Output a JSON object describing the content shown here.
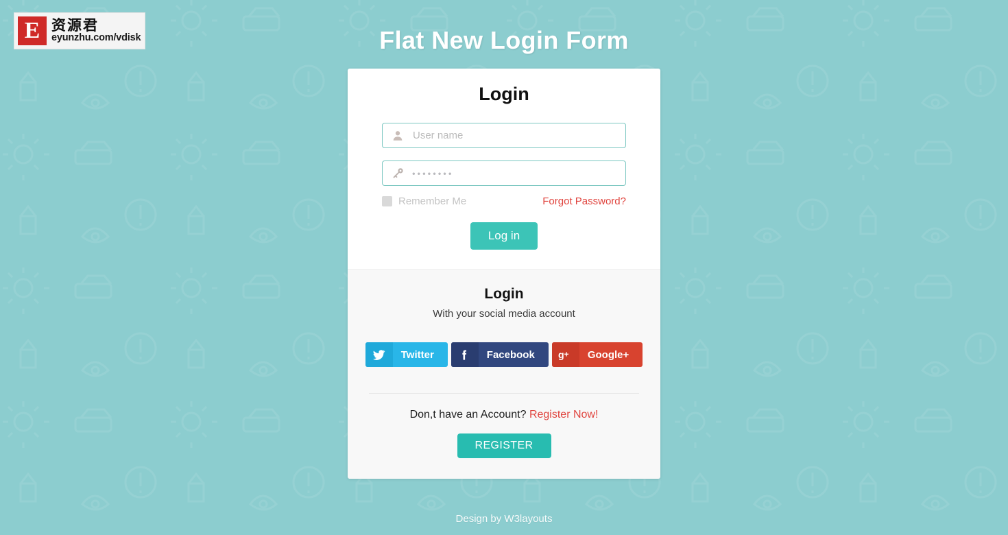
{
  "watermark": {
    "mark_letter": "E",
    "chinese": "资源君",
    "url": "eyunzhu.com/vdisk"
  },
  "page": {
    "title": "Flat New Login Form",
    "background_color": "#8ccdcf"
  },
  "login_card": {
    "heading": "Login",
    "username": {
      "value": "",
      "placeholder": "User name",
      "icon": "user-icon"
    },
    "password": {
      "value": "",
      "masked_display": "••••••••",
      "placeholder": "",
      "icon": "key-icon"
    },
    "remember_label": "Remember Me",
    "remember_checked": false,
    "forgot_label": "Forgot Password?",
    "forgot_color": "#e0443e",
    "submit_label": "Log in",
    "submit_color": "#3cc4b7"
  },
  "social_section": {
    "heading": "Login",
    "subtitle": "With your social media account",
    "buttons": [
      {
        "label": "Twitter",
        "icon": "twitter-icon",
        "color": "#29b6e8"
      },
      {
        "label": "Facebook",
        "icon": "facebook-icon",
        "color": "#31477f"
      },
      {
        "label": "Google+",
        "icon": "google-plus-icon",
        "color": "#d8432f"
      }
    ]
  },
  "register_section": {
    "prompt": "Don,t have an Account?",
    "link_label": "Register Now!",
    "link_color": "#e0443e",
    "button_label": "REGISTER",
    "button_color": "#28bcb0"
  },
  "footer": {
    "text": "Design by W3layouts"
  }
}
